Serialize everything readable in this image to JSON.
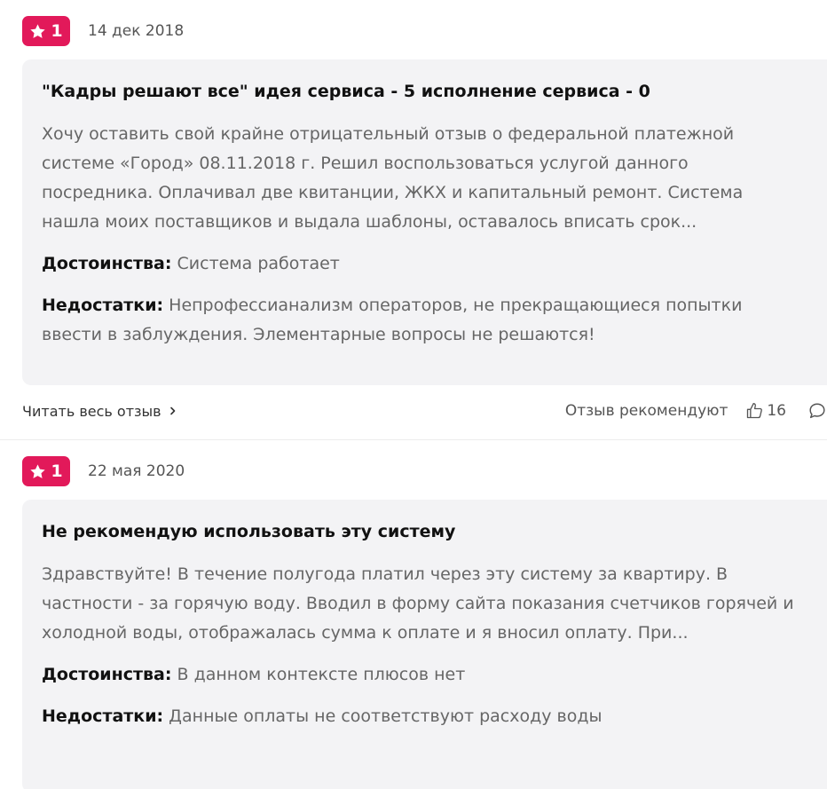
{
  "reviews": [
    {
      "rating": "1",
      "date": "14 дек 2018",
      "title": "\"Кадры решают все\" идея сервиса - 5 исполнение сервиса - 0",
      "body": "Хочу оставить свой крайне отрицательный отзыв о федеральной платежной системе «Город» 08.11.2018 г. Решил воспользоваться услугой данного посредника. Оплачивал две квитанции, ЖКХ и капитальный ремонт. Система нашла моих поставщиков и выдала шаблоны, оставалось вписать срок...",
      "pros_label": "Достоинства:",
      "pros": "Система работает",
      "cons_label": "Недостатки:",
      "cons": "Непрофессианализм операторов, не прекращающиеся попытки ввести в заблуждения. Элементарные вопросы не решаются!",
      "read_more": "Читать весь отзыв",
      "recommend_label": "Отзыв рекомендуют",
      "likes": "16"
    },
    {
      "rating": "1",
      "date": "22 мая 2020",
      "title": "Не рекомендую использовать эту систему",
      "body": "Здравствуйте! В течение полугода платил через эту систему за квартиру. В частности - за горячую воду. Вводил в форму сайта показания счетчиков горячей и холодной воды, отображалась сумма к оплате и я вносил оплату. При...",
      "pros_label": "Достоинства:",
      "pros": "В данном контексте плюсов нет",
      "cons_label": "Недостатки:",
      "cons": "Данные оплаты не соответствуют расходу воды"
    }
  ],
  "colors": {
    "badge": "#e2195a",
    "card_bg": "#f3f3f5"
  }
}
